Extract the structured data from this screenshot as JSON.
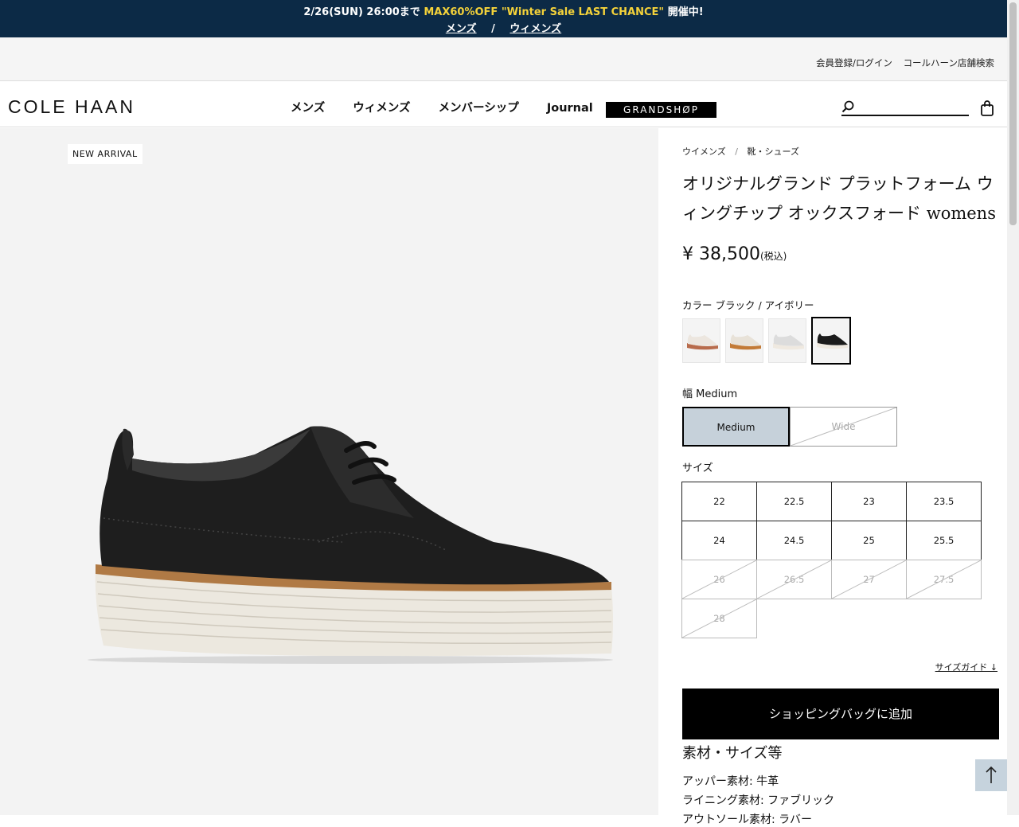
{
  "promo": {
    "line1_prefix": "2/26(SUN) 26:00まで",
    "line1_highlight": "MAX60%OFF \"Winter Sale LAST CHANCE\"",
    "line1_suffix": "開催中!",
    "link_mens": "メンズ",
    "separator": "/",
    "link_womens": "ウィメンズ"
  },
  "utility": {
    "login": "会員登録/ログイン",
    "store_search": "コールハーン店舗検索"
  },
  "header": {
    "logo": "COLE HAAN",
    "nav": [
      "メンズ",
      "ウィメンズ",
      "メンバーシップ",
      "Journal"
    ],
    "grandshop": "GRANDSHØP",
    "search_placeholder": ""
  },
  "gallery": {
    "badge": "NEW ARRIVAL"
  },
  "product": {
    "breadcrumb": [
      "ウイメンズ",
      "靴・シューズ"
    ],
    "breadcrumb_sep": "/",
    "title": "オリジナルグランド プラットフォーム ウィングチップ オックスフォード womens",
    "price": "¥ 38,500",
    "price_tax": "(税込)",
    "color_label": "カラー ブラック / アイボリー",
    "swatches": [
      {
        "name": "ivory-red-sole",
        "upper": "#ece6df",
        "sole": "#b86b4b",
        "selected": false
      },
      {
        "name": "ivory-tan",
        "upper": "#e8e2d8",
        "sole": "#c37a36",
        "selected": false
      },
      {
        "name": "silver-grey",
        "upper": "#dcdcdc",
        "sole": "#efe9e0",
        "selected": false
      },
      {
        "name": "black-ivory",
        "upper": "#1b1b1b",
        "sole": "#efe9e0",
        "selected": true
      }
    ],
    "width_label": "幅 Medium",
    "widths": [
      {
        "label": "Medium",
        "selected": true,
        "available": true
      },
      {
        "label": "Wide",
        "selected": false,
        "available": false
      }
    ],
    "size_label": "サイズ",
    "sizes": [
      {
        "label": "22",
        "available": true
      },
      {
        "label": "22.5",
        "available": true
      },
      {
        "label": "23",
        "available": true
      },
      {
        "label": "23.5",
        "available": true
      },
      {
        "label": "24",
        "available": true
      },
      {
        "label": "24.5",
        "available": true
      },
      {
        "label": "25",
        "available": true
      },
      {
        "label": "25.5",
        "available": true
      },
      {
        "label": "26",
        "available": false
      },
      {
        "label": "26.5",
        "available": false
      },
      {
        "label": "27",
        "available": false
      },
      {
        "label": "27.5",
        "available": false
      },
      {
        "label": "28",
        "available": false
      }
    ],
    "size_guide": "サイズガイド ↓",
    "add_to_bag": "ショッピングバッグに追加",
    "spec_heading": "素材・サイズ等",
    "specs": [
      "アッパー素材: 牛革",
      "ライニング素材: ファブリック",
      "アウトソール素材: ラバー"
    ]
  },
  "back_to_top": "↑"
}
